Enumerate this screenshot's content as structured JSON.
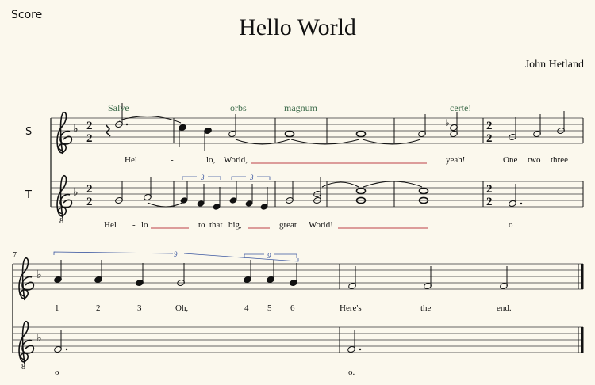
{
  "header": {
    "score_label": "Score",
    "title": "Hello World",
    "composer": "John Hetland"
  },
  "instruments": {
    "soprano": "S",
    "tenor": "T"
  },
  "clef": {
    "octave_mark": "8"
  },
  "time_signature": {
    "numerator": "2",
    "denominator": "2"
  },
  "measure_number": "7",
  "annotations": [
    "Salve",
    "orbs",
    "magnum",
    "certe!"
  ],
  "tuplets": {
    "three": "3",
    "nine": "9"
  },
  "lyrics": {
    "soprano_line1": [
      "Hel",
      "-",
      "lo,",
      "World,",
      "yeah!",
      "One",
      "two",
      "three"
    ],
    "tenor_line1": [
      "Hel",
      "-",
      "lo",
      "to",
      "that",
      "big,",
      "great",
      "World!",
      "o"
    ],
    "soprano_line2": [
      "1",
      "2",
      "3",
      "Oh,",
      "4",
      "5",
      "6",
      "Here's",
      "the",
      "end."
    ],
    "tenor_line2": [
      "o",
      "o."
    ]
  },
  "colors": {
    "background": "#fbf8ed",
    "annotation": "#3c6b4a",
    "extender": "#c9646a",
    "tuplet": "#3a56a0"
  }
}
